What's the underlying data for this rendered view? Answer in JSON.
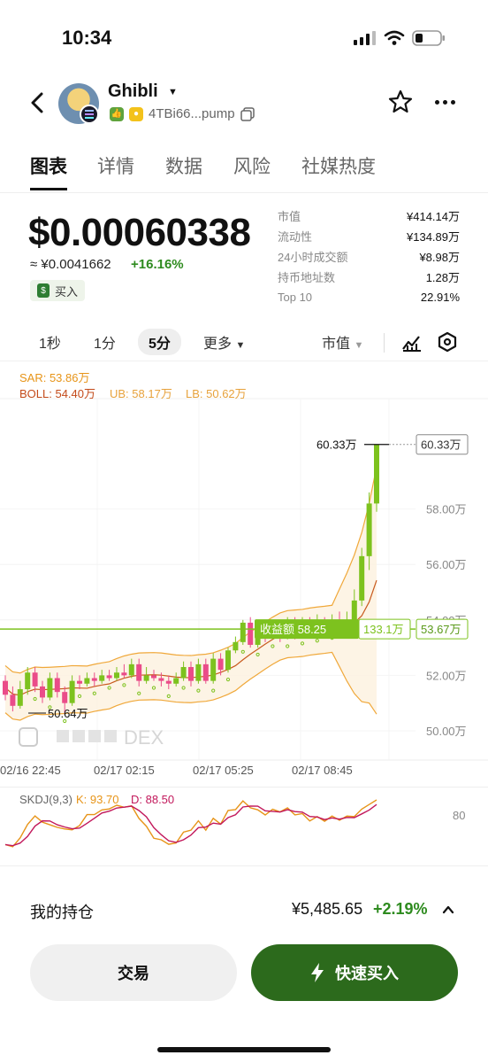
{
  "status_bar": {
    "time": "10:34"
  },
  "header": {
    "token_name": "Ghibli",
    "address": "4TBi66...pump"
  },
  "tabs": [
    "图表",
    "详情",
    "数据",
    "风险",
    "社媒热度"
  ],
  "price": {
    "usd": "$0.00060338",
    "cny": "≈ ¥0.0041662",
    "change": "+16.16%",
    "buy_tag": "买入"
  },
  "stats": [
    {
      "label": "市值",
      "value": "¥414.14万"
    },
    {
      "label": "流动性",
      "value": "¥134.89万"
    },
    {
      "label": "24小时成交额",
      "value": "¥8.98万"
    },
    {
      "label": "持币地址数",
      "value": "1.28万"
    },
    {
      "label": "Top 10",
      "value": "22.91%"
    }
  ],
  "intervals": {
    "options": [
      "1秒",
      "1分",
      "5分"
    ],
    "selected": "5分",
    "more": "更多",
    "metric": "市值"
  },
  "indicators": {
    "sar": "SAR: 53.86万",
    "boll": "BOLL: 54.40万",
    "ub": "UB: 58.17万",
    "lb": "LB: 50.62万"
  },
  "chart_data": {
    "type": "candlestick",
    "unit": "万",
    "y_ticks": [
      "58.00万",
      "56.00万",
      "54.00万",
      "52.00万",
      "50.00万"
    ],
    "ylim": [
      49.2,
      61.6
    ],
    "x_ticks": [
      "02/16 22:45",
      "02/17 02:15",
      "02/17 05:25",
      "02/17 08:45"
    ],
    "high_label": "60.33万",
    "last_price_label": "60.33万",
    "low_label": "50.64万",
    "position_line": {
      "label": "收益额",
      "value": "58.25",
      "amount": "133.1万",
      "price_label": "53.67万",
      "level": 53.67
    },
    "watermark": "DEX",
    "candles": [
      [
        51.8,
        51.3,
        52.0,
        51.1
      ],
      [
        51.3,
        50.9,
        51.6,
        50.7
      ],
      [
        50.9,
        51.5,
        51.8,
        50.8
      ],
      [
        51.5,
        52.1,
        52.3,
        51.3
      ],
      [
        52.1,
        51.6,
        52.3,
        51.4
      ],
      [
        51.6,
        51.2,
        51.8,
        51.0
      ],
      [
        51.2,
        51.9,
        52.1,
        51.1
      ],
      [
        51.9,
        51.4,
        52.1,
        51.2
      ],
      [
        51.4,
        51.0,
        51.6,
        50.6
      ],
      [
        51.0,
        51.8,
        52.0,
        50.9
      ],
      [
        51.8,
        51.7,
        52.0,
        51.5
      ],
      [
        51.7,
        51.9,
        52.1,
        51.6
      ],
      [
        51.9,
        51.8,
        52.1,
        51.6
      ],
      [
        51.8,
        52.0,
        52.2,
        51.7
      ],
      [
        52.0,
        51.9,
        52.2,
        51.8
      ],
      [
        51.9,
        52.1,
        52.3,
        51.8
      ],
      [
        52.1,
        52.0,
        52.4,
        51.9
      ],
      [
        52.0,
        52.4,
        52.6,
        51.9
      ],
      [
        52.4,
        51.8,
        52.6,
        51.6
      ],
      [
        51.8,
        52.0,
        52.3,
        51.7
      ],
      [
        52.0,
        51.9,
        52.2,
        51.8
      ],
      [
        51.9,
        51.8,
        52.1,
        51.6
      ],
      [
        51.8,
        51.7,
        52.0,
        51.5
      ],
      [
        51.7,
        51.9,
        52.1,
        51.6
      ],
      [
        51.9,
        52.3,
        52.5,
        51.8
      ],
      [
        52.3,
        51.8,
        52.5,
        51.6
      ],
      [
        51.8,
        52.4,
        52.6,
        51.7
      ],
      [
        52.4,
        51.8,
        52.6,
        51.7
      ],
      [
        51.8,
        52.6,
        52.8,
        51.7
      ],
      [
        52.6,
        52.2,
        52.8,
        52.0
      ],
      [
        52.2,
        52.9,
        53.0,
        52.1
      ],
      [
        52.9,
        53.2,
        53.4,
        52.8
      ],
      [
        53.2,
        53.9,
        54.0,
        53.1
      ],
      [
        53.9,
        53.1,
        54.1,
        53.0
      ],
      [
        53.1,
        53.6,
        53.8,
        53.0
      ],
      [
        53.6,
        53.4,
        53.8,
        53.2
      ],
      [
        53.4,
        53.8,
        54.0,
        53.3
      ],
      [
        53.8,
        53.4,
        54.0,
        53.2
      ],
      [
        53.4,
        53.9,
        54.1,
        53.3
      ],
      [
        53.9,
        53.5,
        54.1,
        53.3
      ],
      [
        53.5,
        53.8,
        54.1,
        53.4
      ],
      [
        53.8,
        53.6,
        54.1,
        53.4
      ],
      [
        53.6,
        53.9,
        54.2,
        53.5
      ],
      [
        53.9,
        53.7,
        54.1,
        53.5
      ],
      [
        53.7,
        54.0,
        54.2,
        53.6
      ],
      [
        54.0,
        53.8,
        54.3,
        53.6
      ],
      [
        53.8,
        54.0,
        54.3,
        53.7
      ],
      [
        54.0,
        54.7,
        55.1,
        53.9
      ],
      [
        54.7,
        56.3,
        56.6,
        54.5
      ],
      [
        56.3,
        58.2,
        58.6,
        55.8
      ],
      [
        58.2,
        60.33,
        60.33,
        57.9
      ]
    ],
    "boll_lb_end": 50.6,
    "skdj": {
      "k": "93.70",
      "d": "88.50",
      "level_80": "80"
    }
  },
  "skdj": {
    "label": "SKDJ(9,3)",
    "k": "K: 93.70",
    "d": "D: 88.50",
    "level": "80"
  },
  "holding": {
    "label": "我的持仓",
    "value": "¥5,485.65",
    "change": "+2.19%"
  },
  "actions": {
    "trade": "交易",
    "quick_buy": "快速买入"
  },
  "colors": {
    "up": "#7dc21e",
    "down": "#ea4c89",
    "accent": "#2c6a1c",
    "boll": "#e79418"
  }
}
